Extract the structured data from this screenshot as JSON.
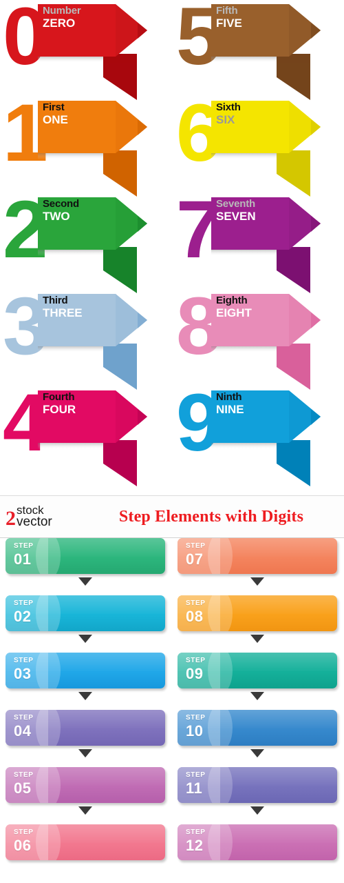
{
  "title_bar": {
    "logo_digit": "2",
    "logo_word1": "stock",
    "logo_word2": "vector",
    "title": "Step Elements with Digits",
    "title_color": "#ee1c20",
    "logo_color": "#e8202a"
  },
  "banners": [
    {
      "digit": "0",
      "top_label": "Number",
      "bottom_label": "ZERO",
      "color": "#d7161c",
      "dark": "#a8070d",
      "mid": "#c21318",
      "top_color": "#b9b9b9",
      "bottom_color": "#ffffff"
    },
    {
      "digit": "1",
      "top_label": "First",
      "bottom_label": "ONE",
      "color": "#f07d0d",
      "dark": "#d06300",
      "mid": "#e37208",
      "top_color": "#111111",
      "bottom_color": "#ffffff"
    },
    {
      "digit": "2",
      "top_label": "Second",
      "bottom_label": "TWO",
      "color": "#2aa53b",
      "dark": "#17832a",
      "mid": "#229a33",
      "top_color": "#111111",
      "bottom_color": "#ffffff"
    },
    {
      "digit": "3",
      "top_label": "Third",
      "bottom_label": "THREE",
      "color": "#a7c4dd",
      "dark": "#6fa2cc",
      "mid": "#93b8d7",
      "top_color": "#111111",
      "bottom_color": "#ffffff"
    },
    {
      "digit": "4",
      "top_label": "Fourth",
      "bottom_label": "FOUR",
      "color": "#e20a63",
      "dark": "#b7004f",
      "mid": "#cf0659",
      "top_color": "#111111",
      "bottom_color": "#ffffff"
    },
    {
      "digit": "5",
      "top_label": "Fifth",
      "bottom_label": "FIVE",
      "color": "#99602c",
      "dark": "#74441b",
      "mid": "#885426",
      "top_color": "#b9b9b9",
      "bottom_color": "#ffffff"
    },
    {
      "digit": "6",
      "top_label": "Sixth",
      "bottom_label": "SIX",
      "color": "#f4e500",
      "dark": "#d4c700",
      "mid": "#e6d800",
      "top_color": "#111111",
      "bottom_color": "#9a9a9a"
    },
    {
      "digit": "7",
      "top_label": "Seventh",
      "bottom_label": "SEVEN",
      "color": "#9c1f8e",
      "dark": "#7c1071",
      "mid": "#8d1a81",
      "top_color": "#b9b9b9",
      "bottom_color": "#ffffff"
    },
    {
      "digit": "8",
      "top_label": "Eighth",
      "bottom_label": "EIGHT",
      "color": "#e88cb8",
      "dark": "#d9609b",
      "mid": "#e378a9",
      "top_color": "#111111",
      "bottom_color": "#ffffff"
    },
    {
      "digit": "9",
      "top_label": "Ninth",
      "bottom_label": "NINE",
      "color": "#11a0da",
      "dark": "#0081b8",
      "mid": "#0b90ca",
      "top_color": "#111111",
      "bottom_color": "#ffffff"
    }
  ],
  "steps": {
    "word": "STEP",
    "items": [
      {
        "num": "01",
        "color": "#2cb67d",
        "color2": "#25a871"
      },
      {
        "num": "02",
        "color": "#18b5d8",
        "color2": "#12a6c9"
      },
      {
        "num": "03",
        "color": "#20a7e8",
        "color2": "#1798dd"
      },
      {
        "num": "04",
        "color": "#7f72bd",
        "color2": "#7366b4"
      },
      {
        "num": "05",
        "color": "#c06cb4",
        "color2": "#b55fab"
      },
      {
        "num": "06",
        "color": "#f2788f",
        "color2": "#ec6a84"
      },
      {
        "num": "07",
        "color": "#f4845e",
        "color2": "#ef7750"
      },
      {
        "num": "08",
        "color": "#f9a11b",
        "color2": "#f19512"
      },
      {
        "num": "09",
        "color": "#14b09a",
        "color2": "#0fa28d"
      },
      {
        "num": "10",
        "color": "#3689cd",
        "color2": "#2d7dc2"
      },
      {
        "num": "11",
        "color": "#7773bd",
        "color2": "#6b67b4"
      },
      {
        "num": "12",
        "color": "#cb70b4",
        "color2": "#c263ab"
      }
    ]
  }
}
